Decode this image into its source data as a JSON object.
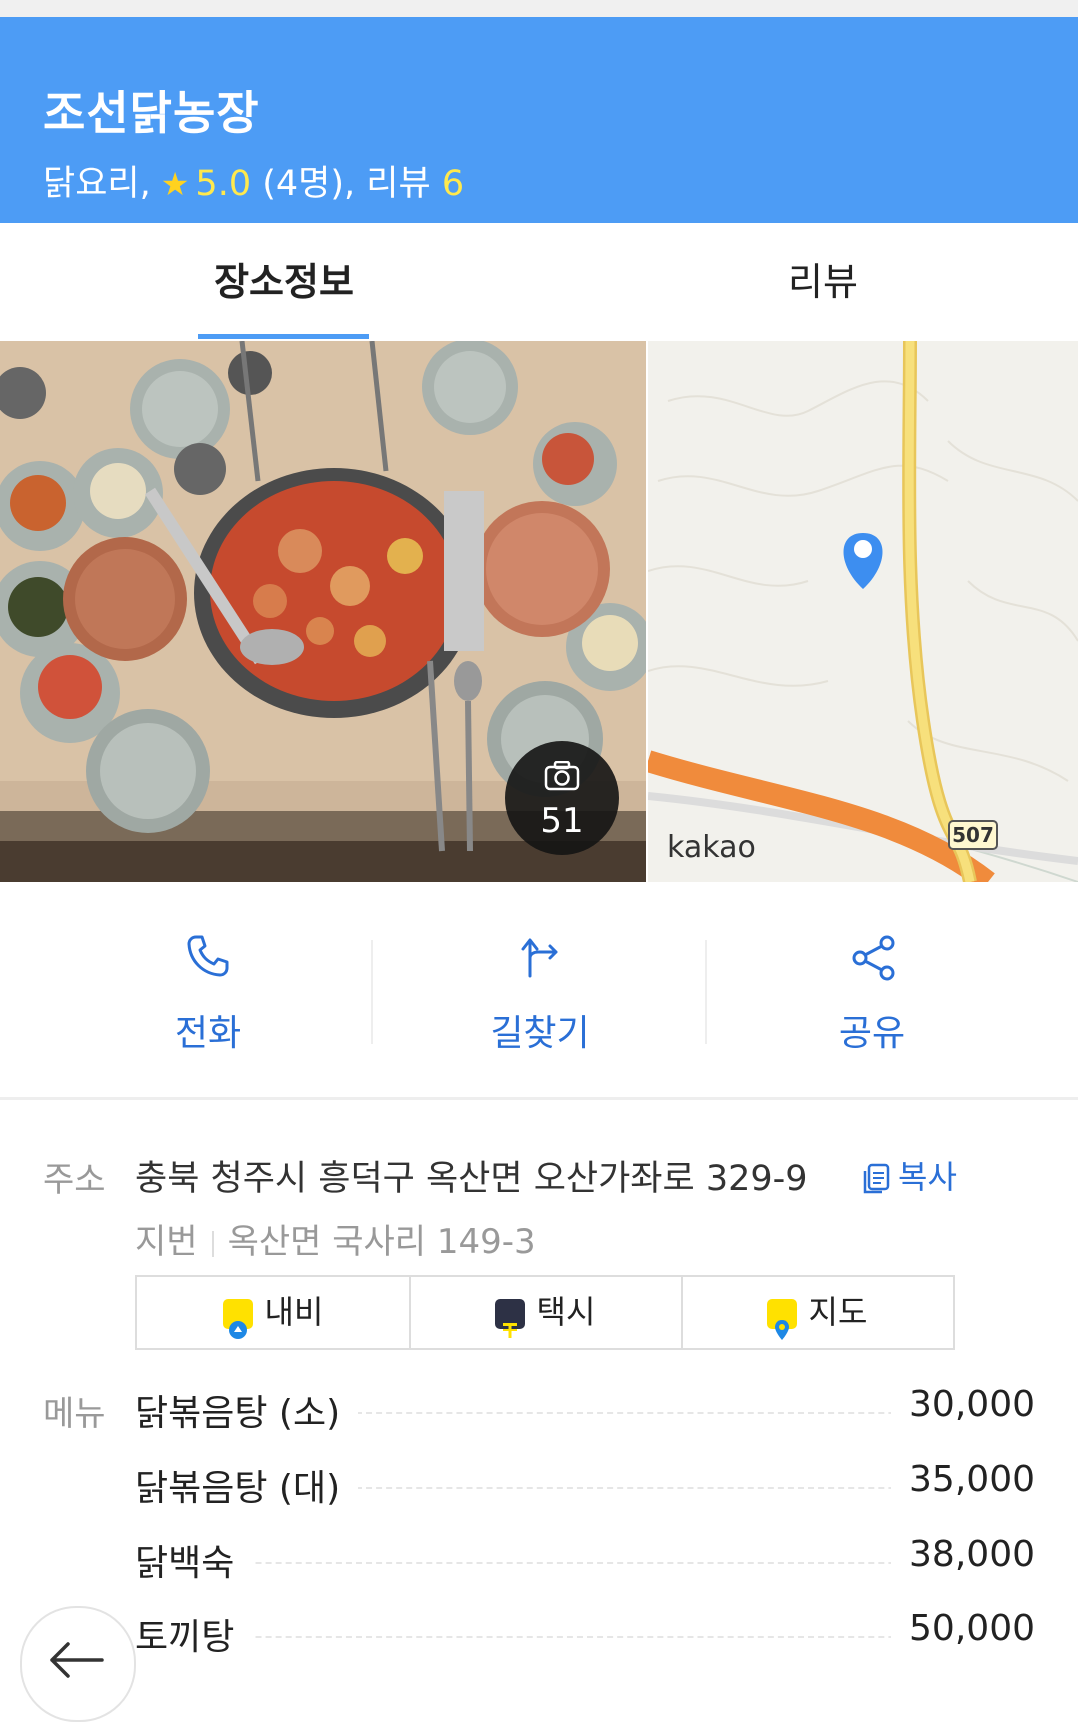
{
  "header": {
    "title": "조선닭농장",
    "category": "닭요리,",
    "rating": "5.0",
    "rating_count": "(4명),",
    "review_label": "리뷰",
    "review_count": "6"
  },
  "tabs": [
    {
      "label": "장소정보",
      "selected": true
    },
    {
      "label": "리뷰",
      "selected": false
    }
  ],
  "media": {
    "photo_count": "51",
    "map_brand": "kakao",
    "map_route_number": "507"
  },
  "actions": [
    {
      "label": "전화",
      "icon": "phone-icon"
    },
    {
      "label": "길찾기",
      "icon": "directions-icon"
    },
    {
      "label": "공유",
      "icon": "share-icon"
    }
  ],
  "address": {
    "label": "주소",
    "road": "충북 청주시 흥덕구 옥산면 오산가좌로 329-9",
    "copy_label": "복사",
    "jibun_label": "지번",
    "jibun": "옥산면 국사리 149-3"
  },
  "nav_buttons": [
    {
      "label": "내비",
      "icon": "navi-icon"
    },
    {
      "label": "택시",
      "icon": "taxi-icon"
    },
    {
      "label": "지도",
      "icon": "map-pin-icon"
    }
  ],
  "menu": {
    "label": "메뉴",
    "items": [
      {
        "name": "닭볶음탕 (소)",
        "price": "30,000"
      },
      {
        "name": "닭볶음탕 (대)",
        "price": "35,000"
      },
      {
        "name": "닭백숙",
        "price": "38,000"
      },
      {
        "name": "토끼탕",
        "price": "50,000"
      }
    ]
  },
  "colors": {
    "header_bg": "#4d9cf5",
    "accent_blue": "#2a6fd6",
    "rating_yellow": "#ffe94d"
  }
}
